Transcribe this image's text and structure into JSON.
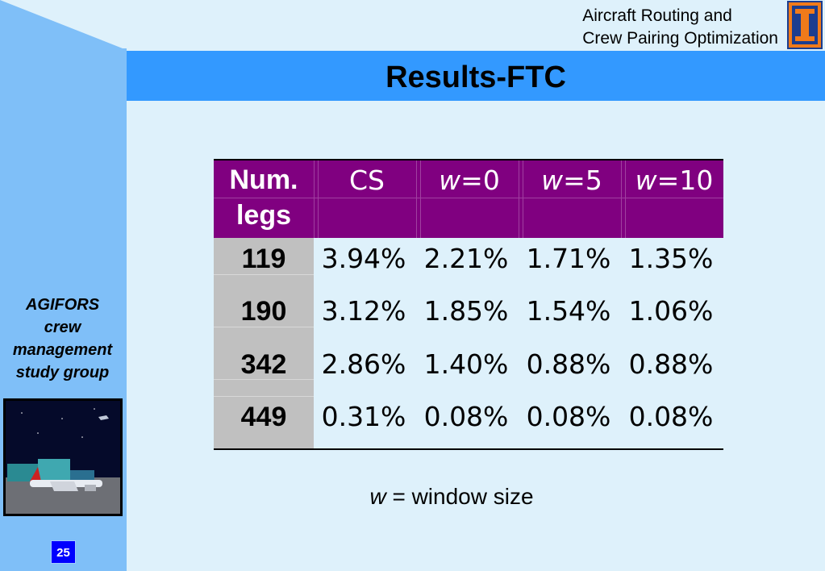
{
  "header": {
    "line1": "Aircraft Routing and",
    "line2": "Crew Pairing Optimization"
  },
  "title": "Results-FTC",
  "side": {
    "label_lines": [
      "AGIFORS",
      "crew",
      "management",
      "study group"
    ],
    "page_number": "25"
  },
  "table": {
    "headers": [
      {
        "pre": "Num.",
        "post": "legs"
      },
      {
        "italic": "",
        "rest": "CS"
      },
      {
        "italic": "w",
        "rest": "=0"
      },
      {
        "italic": "w",
        "rest": "=5"
      },
      {
        "italic": "w",
        "rest": "=10"
      }
    ],
    "rows": [
      {
        "legs": "119",
        "cs": "3.94%",
        "w0": "2.21%",
        "w5": "1.71%",
        "w10": "1.35%"
      },
      {
        "legs": "190",
        "cs": "3.12%",
        "w0": "1.85%",
        "w5": "1.54%",
        "w10": "1.06%"
      },
      {
        "legs": "342",
        "cs": "2.86%",
        "w0": "1.40%",
        "w5": "0.88%",
        "w10": "0.88%"
      },
      {
        "legs": "449",
        "cs": "0.31%",
        "w0": "0.08%",
        "w5": "0.08%",
        "w10": "0.08%"
      }
    ]
  },
  "footnote": {
    "var": "w",
    "text": " = window size"
  },
  "colors": {
    "title_bar": "#3399ff",
    "left_panel": "#7fbff8",
    "table_header": "#800080",
    "first_col": "#c0c0c0",
    "page_badge": "#0000ff"
  }
}
